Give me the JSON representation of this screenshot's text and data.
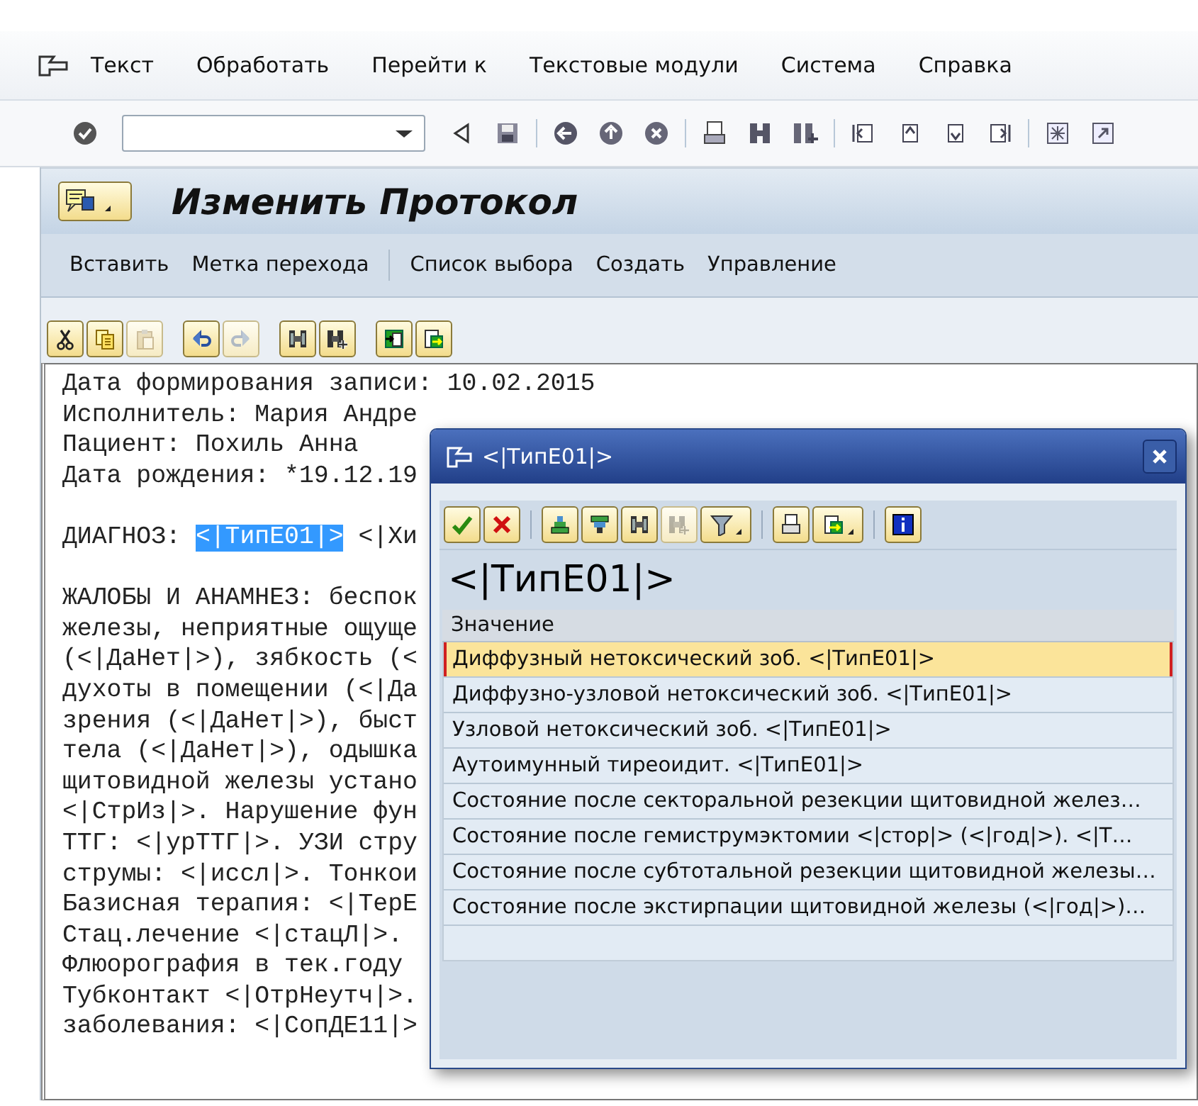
{
  "menu": [
    {
      "label": "Текст"
    },
    {
      "label": "Обработать"
    },
    {
      "label": "Перейти к"
    },
    {
      "label": "Текстовые модули"
    },
    {
      "label": "Система"
    },
    {
      "label": "Справка"
    }
  ],
  "screen_title": "Изменить Протокол",
  "app_toolbar": [
    [
      "Вставить",
      "Метка перехода"
    ],
    [
      "Список выбора",
      "Создать",
      "Управление"
    ]
  ],
  "editor_toolbar": [
    [
      {
        "kind": "cut",
        "disabled": false
      },
      {
        "kind": "copy",
        "disabled": false
      },
      {
        "kind": "paste",
        "disabled": true
      }
    ],
    [
      {
        "kind": "undo",
        "disabled": false
      },
      {
        "kind": "redo",
        "disabled": true
      }
    ],
    [
      {
        "kind": "find",
        "disabled": false
      },
      {
        "kind": "find-next",
        "disabled": false
      }
    ],
    [
      {
        "kind": "upload",
        "disabled": false
      },
      {
        "kind": "download",
        "disabled": false
      }
    ]
  ],
  "editor": {
    "lines": [
      {
        "segments": [
          {
            "text": "Дата формирования записи: 10.02.2015",
            "selected": false
          }
        ]
      },
      {
        "segments": [
          {
            "text": "Исполнитель: Мария Андре",
            "selected": false
          }
        ]
      },
      {
        "segments": [
          {
            "text": "Пациент: Похиль Анна",
            "selected": false
          }
        ]
      },
      {
        "segments": [
          {
            "text": "Дата рождения: *19.12.19",
            "selected": false
          }
        ]
      },
      {
        "blank_before": true,
        "segments": [
          {
            "text": "ДИАГНОЗ: ",
            "selected": false
          },
          {
            "text": "<|ТипE01|>",
            "selected": true
          },
          {
            "text": " <|Хи",
            "selected": false
          }
        ]
      },
      {
        "blank_before": true,
        "segments": [
          {
            "text": "ЖАЛОБЫ И АНАМНЕЗ: беспок",
            "selected": false
          }
        ]
      },
      {
        "segments": [
          {
            "text": "железы, неприятные ощуще",
            "selected": false
          }
        ]
      },
      {
        "segments": [
          {
            "text": "(<|ДаНет|>), зябкость (<",
            "selected": false
          }
        ]
      },
      {
        "segments": [
          {
            "text": "духоты в помещении (<|Да",
            "selected": false
          }
        ]
      },
      {
        "segments": [
          {
            "text": "зрения (<|ДаНет|>), быст",
            "selected": false
          }
        ]
      },
      {
        "segments": [
          {
            "text": "тела (<|ДаНет|>), одышка",
            "selected": false
          }
        ]
      },
      {
        "segments": [
          {
            "text": "щитовидной железы устано",
            "selected": false
          }
        ]
      },
      {
        "segments": [
          {
            "text": "<|СтрИз|>. Нарушение фун",
            "selected": false
          }
        ]
      },
      {
        "segments": [
          {
            "text": "ТТГ: <|урТТГ|>. УЗИ стру",
            "selected": false
          }
        ]
      },
      {
        "segments": [
          {
            "text": "струмы: <|иссл|>. Тонкои",
            "selected": false
          }
        ]
      },
      {
        "segments": [
          {
            "text": "Базисная терапия: <|ТерE",
            "selected": false
          }
        ]
      },
      {
        "segments": [
          {
            "text": "Стац.лечение <|стацЛ|>.",
            "selected": false
          }
        ]
      },
      {
        "segments": [
          {
            "text": "Флюорография в тек.году",
            "selected": false
          }
        ]
      },
      {
        "segments": [
          {
            "text": "Тубконтакт <|ОтрНеутч|>.",
            "selected": false
          }
        ]
      },
      {
        "segments": [
          {
            "text": "заболевания: <|СопДЕ11|>",
            "selected": false
          }
        ]
      }
    ]
  },
  "dialog": {
    "title": "<|ТипE01|>",
    "toolbar": [
      [
        {
          "kind": "ok",
          "disabled": false
        },
        {
          "kind": "cancel",
          "disabled": false
        }
      ],
      [
        {
          "kind": "sort-asc",
          "disabled": false
        },
        {
          "kind": "sort-desc",
          "disabled": false
        },
        {
          "kind": "find",
          "disabled": false
        },
        {
          "kind": "find-next",
          "disabled": true
        },
        {
          "kind": "filter",
          "disabled": false,
          "dropdown": true
        }
      ],
      [
        {
          "kind": "print",
          "disabled": false
        },
        {
          "kind": "export",
          "disabled": false,
          "dropdown": true
        }
      ],
      [
        {
          "kind": "info",
          "disabled": false
        }
      ]
    ],
    "heading": "<|ТипE01|>",
    "column": "Значение",
    "rows": [
      {
        "text": "Диффузный нетоксический зоб. <|ТипE01|>",
        "selected": true
      },
      {
        "text": "Диффузно-узловой нетоксический зоб. <|ТипE01|>",
        "selected": false
      },
      {
        "text": "Узловой нетоксический зоб. <|ТипE01|>",
        "selected": false
      },
      {
        "text": "Аутоимунный тиреоидит. <|ТипE01|>",
        "selected": false
      },
      {
        "text": "Состояние после секторальной резекции щитовидной желез…",
        "selected": false
      },
      {
        "text": "Состояние после гемиструмэктомии <|стор|> (<|год|>). <|Т…",
        "selected": false
      },
      {
        "text": "Состояние после субтотальной резекции щитовидной железы…",
        "selected": false
      },
      {
        "text": "Состояние после экстирпации щитовидной железы (<|год|>)…",
        "selected": false
      }
    ]
  }
}
